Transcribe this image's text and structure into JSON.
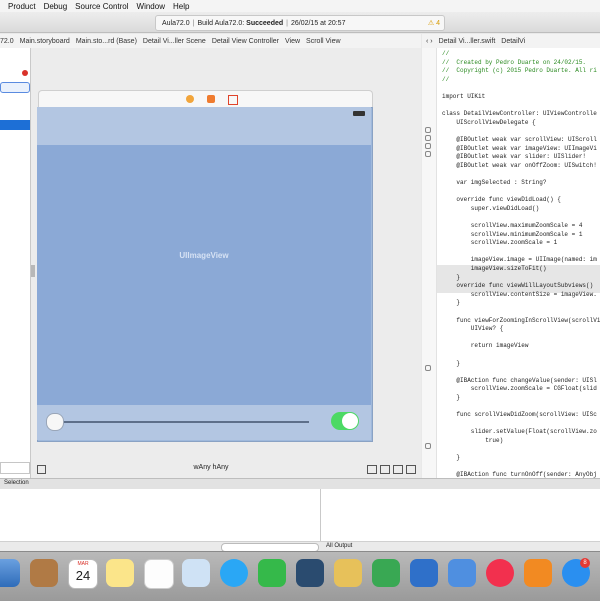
{
  "menubar": [
    "Product",
    "Debug",
    "Source Control",
    "Window",
    "Help"
  ],
  "toolbar": {
    "status": {
      "project": "Aula72.0",
      "build_label": "Build Aula72.0:",
      "build_result": "Succeeded",
      "datetime": "26/02/15 at 20:57",
      "warnings": "4"
    }
  },
  "jumpbar_left": [
    "72.0",
    "Main.storyboard",
    "Main.sto...rd (Base)",
    "Detail Vi...ller Scene",
    "Detail View Controller",
    "View",
    "Scroll View"
  ],
  "jumpbar_right": [
    "Detail Vi...ller.swift",
    "DetailVi"
  ],
  "canvas": {
    "image_view_label": "UIImageView",
    "size_class": "wAny hAny"
  },
  "code": [
    "//",
    "//  Created by Pedro Duarte on 24/02/15.",
    "//  Copyright (c) 2015 Pedro Duarte. All ri",
    "//",
    "",
    "import UIKit",
    "",
    "class DetailViewController: UIViewControlle",
    "    UIScrollViewDelegate {",
    "",
    "    @IBOutlet weak var scrollView: UIScroll",
    "    @IBOutlet weak var imageView: UIImageVi",
    "    @IBOutlet weak var slider: UISlider!",
    "    @IBOutlet weak var onOffZoom: UISwitch!",
    "",
    "    var imgSelected : String?",
    "",
    "    override func viewDidLoad() {",
    "        super.viewDidLoad()",
    "",
    "        scrollView.maximumZoomScale = 4",
    "        scrollView.minimumZoomScale = 1",
    "        scrollView.zoomScale = 1",
    "",
    "        imageView.image = UIImage(named: im",
    "        imageView.sizeToFit()",
    "    }",
    "    override func viewWillLayoutSubviews()",
    "        scrollView.contentSize = imageView.",
    "    }",
    "",
    "    func viewForZoomingInScrollView(scrollVi",
    "        UIView? {",
    "",
    "        return imageView",
    "",
    "    }",
    "",
    "    @IBAction func changeValue(sender: UISl",
    "        scrollView.zoomScale = CGFloat(slid",
    "    }",
    "",
    "    func scrollViewDidZoom(scrollView: UISc",
    "",
    "        slider.setValue(Float(scrollView.zo",
    "            true)",
    "",
    "    }",
    "",
    "    @IBAction func turnOnOff(sender: AnyObj",
    "",
    "        slider.enabled = onOffZoom.on",
    "",
    "        scrollView.pinchGestureRecognizer.e"
  ],
  "debug": {
    "title": "Selection",
    "output_filter": "All Output"
  },
  "dock": {
    "calendar_month": "MAR",
    "calendar_day": "24",
    "badge_count": "8"
  },
  "colors": {
    "image_view": "#8ba9d6",
    "switch_on": "#4cd964",
    "accent": "#1d6fd6"
  }
}
